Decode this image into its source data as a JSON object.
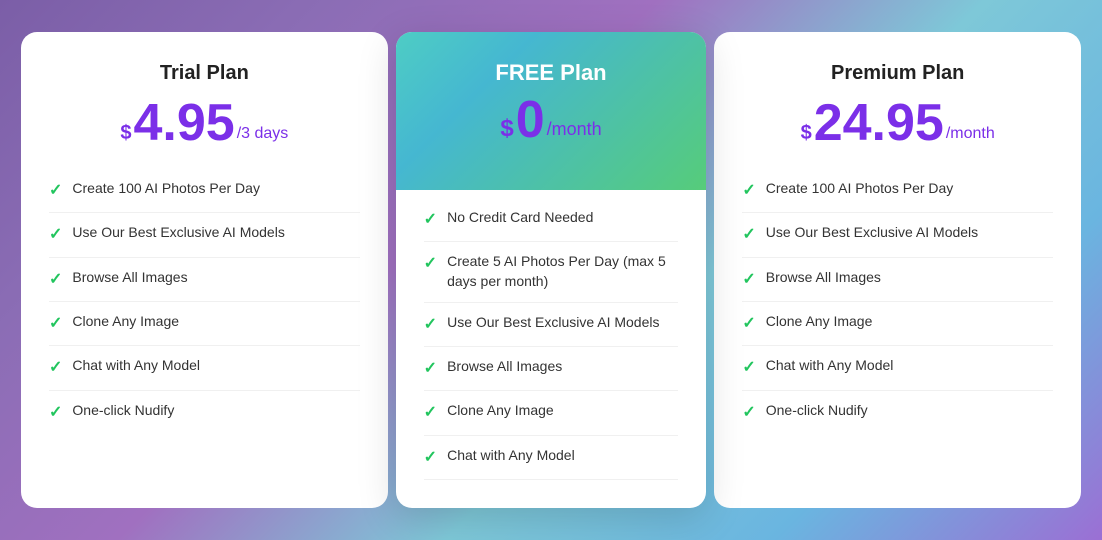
{
  "plans": {
    "trial": {
      "name": "Trial Plan",
      "price_dollar": "$",
      "price_amount": "4.95",
      "price_period": "/3 days",
      "features": [
        "Create 100 AI Photos Per Day",
        "Use Our Best Exclusive AI Models",
        "Browse All Images",
        "Clone Any Image",
        "Chat with Any Model",
        "One-click Nudify"
      ]
    },
    "free": {
      "name": "FREE Plan",
      "price_dollar": "$",
      "price_amount": "0",
      "price_period": "/month",
      "features": [
        "No Credit Card Needed",
        "Create 5 AI Photos Per Day (max 5 days per month)",
        "Use Our Best Exclusive AI Models",
        "Browse All Images",
        "Clone Any Image",
        "Chat with Any Model"
      ]
    },
    "premium": {
      "name": "Premium Plan",
      "price_dollar": "$",
      "price_amount": "24.95",
      "price_period": "/month",
      "features": [
        "Create 100 AI Photos Per Day",
        "Use Our Best Exclusive AI Models",
        "Browse All Images",
        "Clone Any Image",
        "Chat with Any Model",
        "One-click Nudify"
      ]
    }
  },
  "icons": {
    "check": "✓"
  }
}
